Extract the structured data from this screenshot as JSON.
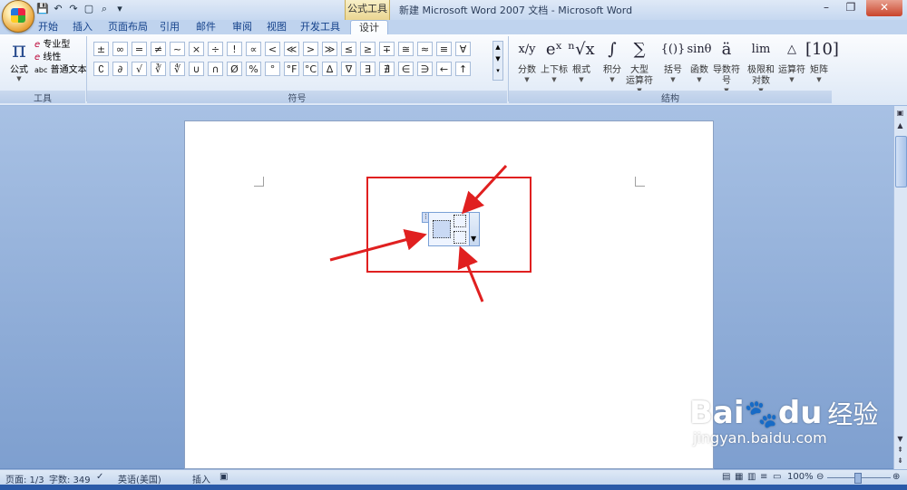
{
  "window": {
    "title": "新建 Microsoft Word 2007 文档 - Microsoft Word",
    "context_tool": "公式工具"
  },
  "tabs": [
    "开始",
    "插入",
    "页面布局",
    "引用",
    "邮件",
    "审阅",
    "视图",
    "开发工具",
    "设计"
  ],
  "tools_group": {
    "label": "工具",
    "equation_label": "公式",
    "pro_label": "专业型",
    "linear_label": "线性",
    "plain_label": "普通文本",
    "abc": "abc"
  },
  "symbols_group": {
    "label": "符号",
    "row1": [
      "±",
      "∞",
      "=",
      "≠",
      "~",
      "×",
      "÷",
      "!",
      "∝",
      "<",
      "≪",
      ">",
      "≫",
      "≤",
      "≥",
      "∓",
      "≅",
      "≈",
      "≡",
      "∀"
    ],
    "row2": [
      "∁",
      "∂",
      "√",
      "∛",
      "∜",
      "∪",
      "∩",
      "Ø",
      "%",
      "°",
      "°F",
      "°C",
      "∆",
      "∇",
      "∃",
      "∄",
      "∈",
      "∋",
      "←",
      "↑"
    ]
  },
  "structures_group": {
    "label": "结构",
    "items": [
      {
        "icon": "x/y",
        "label": "分数"
      },
      {
        "icon": "eˣ",
        "label": "上下标"
      },
      {
        "icon": "ⁿ√x",
        "label": "根式"
      },
      {
        "icon": "∫",
        "label": "积分"
      },
      {
        "icon": "∑",
        "label": "大型\n运算符"
      },
      {
        "icon": "{()}",
        "label": "括号"
      },
      {
        "icon": "sinθ",
        "label": "函数"
      },
      {
        "icon": "ä",
        "label": "导数符号"
      },
      {
        "icon": "lim",
        "label": "极限和\n对数"
      },
      {
        "icon": "△",
        "label": "运算符"
      },
      {
        "icon": "[10]",
        "label": "矩阵"
      }
    ]
  },
  "status": {
    "page": "页面: 1/3",
    "words": "字数: 349",
    "language": "英语(美国)",
    "mode": "插入",
    "zoom": "100%"
  },
  "watermark": {
    "brand": "Bai",
    "brand2": "du",
    "cn": "经验",
    "url": "jingyan.baidu.com"
  }
}
